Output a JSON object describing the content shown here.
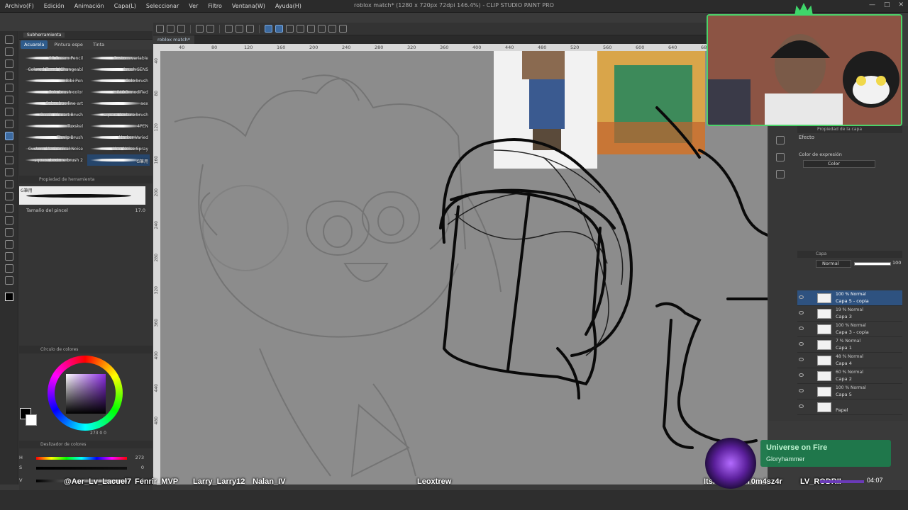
{
  "window": {
    "title": "roblox match* (1280 x 720px 72dpi 146.4%) - CLIP STUDIO PAINT PRO"
  },
  "menu": [
    "Archivo(F)",
    "Edición",
    "Animación",
    "Capa(L)",
    "Seleccionar",
    "Ver",
    "Filtro",
    "Ventana(W)",
    "Ayuda(H)"
  ],
  "subtool_panel": {
    "header": "Subherramienta",
    "tabs": [
      "Acuarela",
      "Pintura espe",
      "Tinta"
    ],
    "brushes": [
      {
        "label": "Sil Cream Pencil"
      },
      {
        "label": "Custom variable"
      },
      {
        "label": "Colored Tread (Changeabl"
      },
      {
        "label": "brush SENS"
      },
      {
        "label": "Bibi Pen"
      },
      {
        "label": "Colo brush"
      },
      {
        "label": "Colo brush color"
      },
      {
        "label": "HIMOG modified"
      },
      {
        "label": "Subsebue line art"
      },
      {
        "label": "aex"
      },
      {
        "label": "Comic Lineart Brush"
      },
      {
        "label": "square texture brush"
      },
      {
        "label": "Tuxskel"
      },
      {
        "label": "4PEN"
      },
      {
        "label": "Thwip Brush"
      },
      {
        "label": "Marker Varied"
      },
      {
        "label": "Custom Mechanical Noise"
      },
      {
        "label": "Line Noise Spray"
      },
      {
        "label": "square texture brush 2"
      },
      {
        "label": "G筆用"
      }
    ]
  },
  "tool_property": {
    "header": "Propiedad de herramienta",
    "brush_name": "G筆用",
    "size_label": "Tamaño del pincel",
    "size_value": "17.0"
  },
  "color_wheel": {
    "header": "Círculo de colores",
    "readout": "273 0 0"
  },
  "color_slider": {
    "header": "Deslizador de colores",
    "h_label": "H",
    "h_value": "273",
    "s_label": "S",
    "s_value": "0",
    "v_label": "V",
    "v_value": "0"
  },
  "document": {
    "tab": "roblox match*",
    "ruler_top": [
      "40",
      "80",
      "120",
      "160",
      "200",
      "240",
      "280",
      "320",
      "360",
      "400",
      "440",
      "480",
      "520",
      "560",
      "600",
      "640",
      "680"
    ],
    "ruler_left": [
      "40",
      "80",
      "120",
      "160",
      "200",
      "240",
      "280",
      "320",
      "360",
      "400",
      "440",
      "480"
    ]
  },
  "layer_property": {
    "header": "Propiedad de la capa",
    "effect_label": "Efecto",
    "color_expression_label": "Color de expresión",
    "color_expression_value": "Color"
  },
  "layers_panel": {
    "header": "Capa",
    "blend_mode": "Normal",
    "opacity": "100",
    "layers": [
      {
        "mode": "100 % Normal",
        "name": "Capa 5 - copia",
        "selected": true
      },
      {
        "mode": "19 % Normal",
        "name": "Capa 3",
        "selected": false
      },
      {
        "mode": "100 % Normal",
        "name": "Capa 3 - copia",
        "selected": false
      },
      {
        "mode": "7 % Normal",
        "name": "Capa 1",
        "selected": false
      },
      {
        "mode": "48 % Normal",
        "name": "Capa 4",
        "selected": false
      },
      {
        "mode": "60 % Normal",
        "name": "Capa 2",
        "selected": false
      },
      {
        "mode": "100 % Normal",
        "name": "Capa 5",
        "selected": false
      },
      {
        "mode": "",
        "name": "Papel",
        "selected": false
      }
    ]
  },
  "stream": {
    "chatters": [
      "@Aer_Lv_Lacuel7",
      "Fenrir_MVP",
      "Larry_Larry12",
      "Nalan_IV",
      "Leoxtrew",
      "ItsMayPar",
      "T0m4sz4r",
      "LV_RODRII"
    ],
    "now_playing": {
      "title": "Universe on Fire",
      "artist": "Gloryhammer",
      "time": "04:07"
    }
  },
  "colors": {
    "accent": "#2f5c8c",
    "canvas_bg": "#8c8c8c",
    "webcam_border": "#4cd36a",
    "now_playing_bg": "#1e7a4c"
  }
}
